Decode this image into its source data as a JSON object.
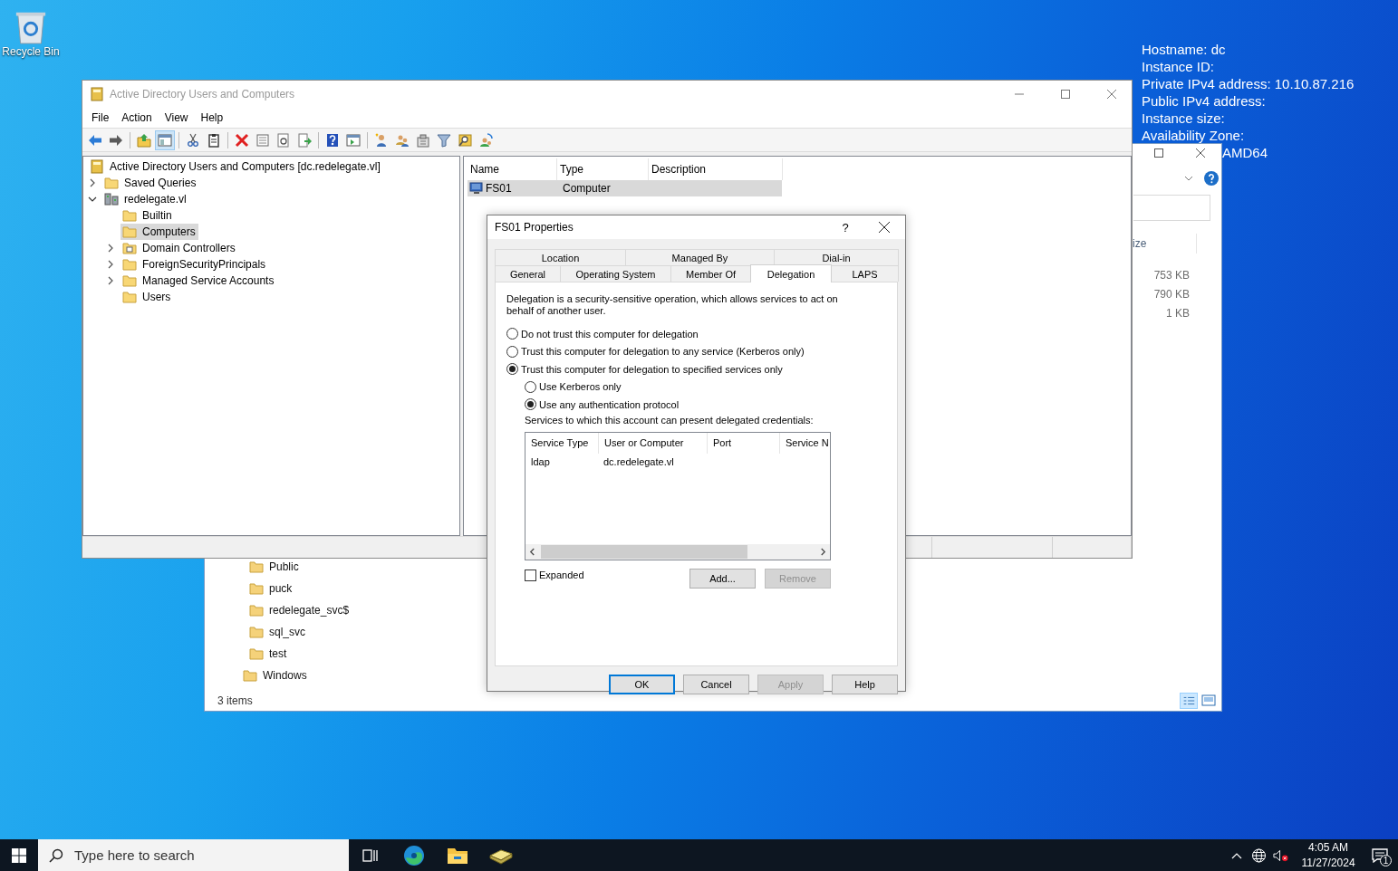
{
  "desktop": {
    "icons": [
      {
        "label": "Recycle Bin"
      }
    ],
    "bginfo": [
      "Hostname: dc",
      "Instance ID:",
      "Private IPv4 address: 10.10.87.216",
      "Public IPv4 address:",
      "Instance size:",
      "Availability Zone:"
    ],
    "bginfo_fragment": "AMD64"
  },
  "explorer_window": {
    "size_header": "ize",
    "sizes": [
      "753 KB",
      "790 KB",
      "1 KB"
    ],
    "nav_subfolders": [
      {
        "label": "Public"
      },
      {
        "label": "puck"
      },
      {
        "label": "redelegate_svc$"
      },
      {
        "label": "sql_svc"
      },
      {
        "label": "test"
      }
    ],
    "nav_folder": "Windows",
    "status": "3 items"
  },
  "aduc": {
    "title": "Active Directory Users and Computers",
    "menu": [
      "File",
      "Action",
      "View",
      "Help"
    ],
    "toolbar": {
      "console_tree_shown": true
    },
    "tree": [
      {
        "label": "Active Directory Users and Computers [dc.redelegate.vl]",
        "kind": "snapin",
        "selected": false,
        "children": [
          {
            "label": "Saved Queries",
            "kind": "container",
            "expandable": true,
            "expanded": false,
            "selected": false
          },
          {
            "label": "redelegate.vl",
            "kind": "domain",
            "expandable": true,
            "expanded": true,
            "selected": false,
            "children": [
              {
                "label": "Builtin",
                "kind": "container",
                "expandable": false,
                "selected": false
              },
              {
                "label": "Computers",
                "kind": "container",
                "expandable": false,
                "selected": true
              },
              {
                "label": "Domain Controllers",
                "kind": "ou",
                "expandable": true,
                "expanded": false,
                "selected": false
              },
              {
                "label": "ForeignSecurityPrincipals",
                "kind": "container",
                "expandable": true,
                "expanded": false,
                "selected": false
              },
              {
                "label": "Managed Service Accounts",
                "kind": "container",
                "expandable": true,
                "expanded": false,
                "selected": false
              },
              {
                "label": "Users",
                "kind": "container",
                "expandable": false,
                "selected": false
              }
            ]
          }
        ]
      }
    ],
    "columns": [
      "Name",
      "Type",
      "Description"
    ],
    "rows": [
      {
        "name": "FS01",
        "type": "Computer",
        "selected": true
      }
    ]
  },
  "dialog": {
    "title": "FS01 Properties",
    "help_glyph": "?",
    "tab_rows": [
      [
        {
          "label": "Location",
          "selected": false
        },
        {
          "label": "Managed By",
          "selected": false
        },
        {
          "label": "Dial-in",
          "selected": false
        }
      ],
      [
        {
          "label": "General",
          "selected": false
        },
        {
          "label": "Operating System",
          "selected": false
        },
        {
          "label": "Member Of",
          "selected": false
        },
        {
          "label": "Delegation",
          "selected": true
        },
        {
          "label": "LAPS",
          "selected": false
        }
      ]
    ],
    "description": "Delegation is a security-sensitive operation, which allows services to act on behalf of another user.",
    "delegation_options": [
      {
        "label": "Do not trust this computer for delegation",
        "selected": false
      },
      {
        "label": "Trust this computer for delegation to any service (Kerberos only)",
        "selected": false
      },
      {
        "label": "Trust this computer for delegation to specified services only",
        "selected": true
      }
    ],
    "protocol_options": [
      {
        "label": "Use Kerberos only",
        "selected": false
      },
      {
        "label": "Use any authentication protocol",
        "selected": true
      }
    ],
    "services_label": "Services to which this account can present delegated credentials:",
    "services": {
      "columns": [
        "Service Type",
        "User or Computer",
        "Port",
        "Service N"
      ],
      "rows": [
        [
          "ldap",
          "dc.redelegate.vl"
        ]
      ]
    },
    "expanded": {
      "label": "Expanded",
      "checked": false
    },
    "list_buttons": [
      {
        "label": "Add...",
        "disabled": false
      },
      {
        "label": "Remove",
        "disabled": true
      }
    ],
    "buttons": [
      {
        "label": "OK",
        "default": true,
        "disabled": false
      },
      {
        "label": "Cancel",
        "default": false,
        "disabled": false
      },
      {
        "label": "Apply",
        "default": false,
        "disabled": true
      },
      {
        "label": "Help",
        "default": false,
        "disabled": false
      }
    ]
  },
  "taskbar": {
    "search_placeholder": "Type here to search",
    "time": "4:05 AM",
    "date": "11/27/2024",
    "notification_count": "1"
  }
}
